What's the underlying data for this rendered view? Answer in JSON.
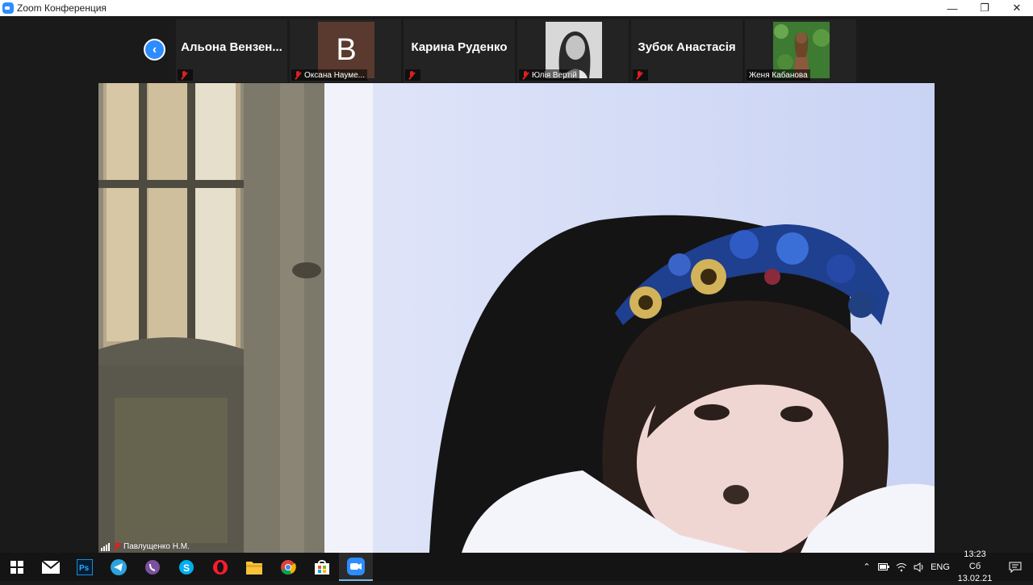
{
  "window": {
    "title": "Zoom Конференция",
    "controls": [
      "minimize",
      "restore",
      "close"
    ]
  },
  "participants": [
    {
      "display_name": "Альона Вензен...",
      "caption": "",
      "type": "name-only",
      "muted": true
    },
    {
      "display_name": "",
      "caption": "Оксана Науме...",
      "type": "letter",
      "letter": "B",
      "muted": true
    },
    {
      "display_name": "Карина Руденко",
      "caption": "",
      "type": "name-only",
      "muted": true
    },
    {
      "display_name": "",
      "caption": "Юлія Вертій",
      "type": "photo",
      "muted": true
    },
    {
      "display_name": "Зубок Анастасія",
      "caption": "",
      "type": "name-only",
      "muted": true
    },
    {
      "display_name": "",
      "caption": "Женя Кабанова",
      "type": "photo",
      "muted": false
    }
  ],
  "active_speaker": {
    "name": "Павлущенко Н.М.",
    "muted": true
  },
  "taskbar": {
    "apps": [
      "windows-start-icon",
      "mail-icon",
      "photoshop-icon",
      "telegram-icon",
      "viber-icon",
      "skype-icon",
      "opera-icon",
      "file-explorer-icon",
      "chrome-icon",
      "store-icon",
      "zoom-icon"
    ],
    "active_app": "zoom-icon",
    "tray": {
      "language": "ENG",
      "time": "13:23",
      "date": "Сб 13.02.21"
    }
  },
  "colors": {
    "zoom_blue": "#2d8cff",
    "mute_red": "#e02020",
    "background": "#1a1a1a"
  }
}
